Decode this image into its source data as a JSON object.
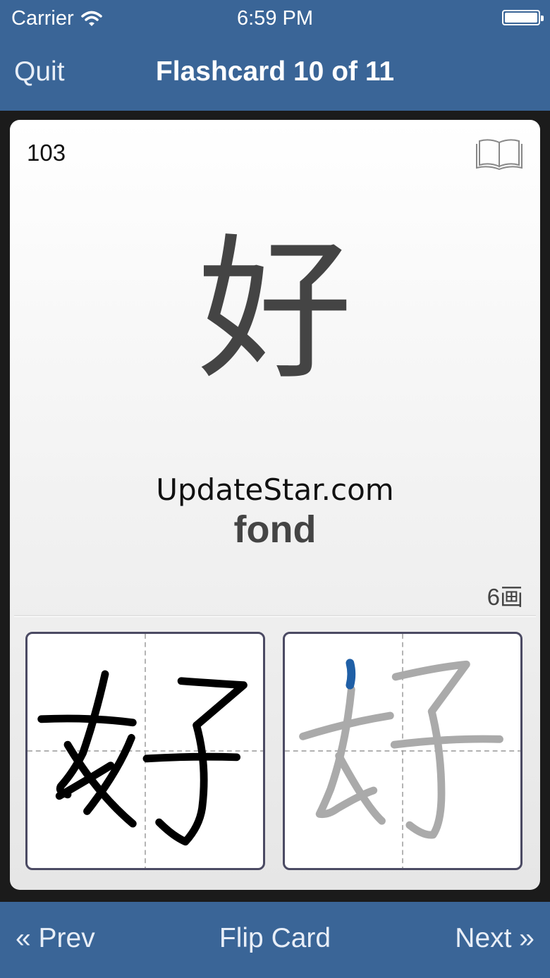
{
  "status_bar": {
    "carrier": "Carrier",
    "time": "6:59 PM",
    "wifi_icon": "wifi-icon",
    "battery_icon": "battery-icon"
  },
  "nav": {
    "quit_label": "Quit",
    "title": "Flashcard 10 of 11"
  },
  "card": {
    "number": "103",
    "book_icon": "book-icon",
    "kanji": "好",
    "watermark": "UpdateStar.com",
    "meaning": "fond",
    "stroke_count": "6画"
  },
  "toolbar": {
    "prev_label": "« Prev",
    "flip_label": "Flip Card",
    "next_label": "Next »"
  },
  "colors": {
    "bar": "#3a6597",
    "highlight_stroke": "#1f5fa6",
    "guide_stroke": "#aaaaaa"
  }
}
